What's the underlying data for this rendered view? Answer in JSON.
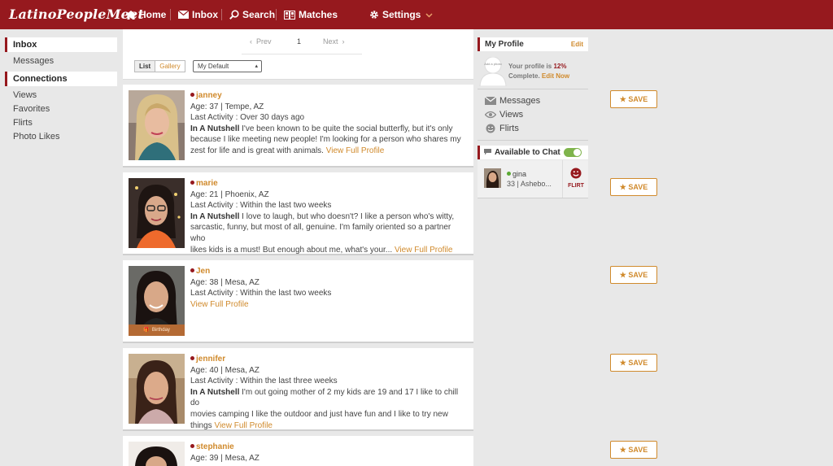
{
  "header": {
    "logo": "LatinoPeopleMeet",
    "nav": [
      {
        "label": "Home"
      },
      {
        "label": "Inbox"
      },
      {
        "label": "Search"
      },
      {
        "label": "Matches"
      },
      {
        "label": "Settings"
      }
    ]
  },
  "sidebar": {
    "inbox_header": "Inbox",
    "inbox_items": [
      "Messages"
    ],
    "connections_header": "Connections",
    "connections_items": [
      "Views",
      "Favorites",
      "Flirts",
      "Photo Likes"
    ]
  },
  "pager": {
    "prev": "Prev",
    "page": "1",
    "next": "Next",
    "view_list": "List",
    "view_gallery": "Gallery",
    "sort_selected": "My Default"
  },
  "profiles": [
    {
      "name": "janney",
      "age_loc": "Age: 37 | Tempe, AZ",
      "activity": "Last Activity : Over 30 days ago",
      "nutshell_label": "In A Nutshell",
      "lines": [
        "I've been known to be quite the social butterfly, but it's only",
        "because I like meeting new people! I'm looking for a person who shares my",
        "zest for life and is great with animals."
      ],
      "link": "View Full Profile"
    },
    {
      "name": "marie",
      "age_loc": "Age: 21 | Phoenix, AZ",
      "activity": "Last Activity : Within the last two weeks",
      "nutshell_label": "In A Nutshell",
      "lines": [
        "I love to laugh, but who doesn't? I like a person who's witty,",
        "sarcastic, funny, but most of all, genuine. I'm family oriented so a partner who",
        "likes kids is a must! But enough about me, what's your..."
      ],
      "link": "View Full Profile"
    },
    {
      "name": "Jen",
      "age_loc": "Age: 38 | Mesa, AZ",
      "activity": "Last Activity : Within the last two weeks",
      "link": "View Full Profile",
      "badge": "Birthday"
    },
    {
      "name": "jennifer",
      "age_loc": "Age: 40 | Mesa, AZ",
      "activity": "Last Activity : Within the last three weeks",
      "nutshell_label": "In A Nutshell",
      "lines": [
        "I'm out going mother of 2 my kids are 19 and 17 I like to chill do",
        "movies camping I like the outdoor and just have fun and I like to try new",
        "things"
      ],
      "link": "View Full Profile"
    },
    {
      "name": "stephanie",
      "age_loc": "Age: 39 | Mesa, AZ"
    }
  ],
  "my_profile": {
    "title": "My Profile",
    "edit": "Edit",
    "add_photo": "Add a photo",
    "progress_prefix": "Your profile is",
    "progress_pct": "12%",
    "progress_suffix": "Complete.",
    "edit_now": "Edit Now",
    "links": [
      "Messages",
      "Views",
      "Flirts"
    ]
  },
  "chat": {
    "title": "Available to Chat",
    "user_name": "gina",
    "user_sub": "33 | Ashebo...",
    "flirt": "FLIRT"
  },
  "save_label": "SAVE",
  "colors": {
    "brand": "#96191e",
    "accent": "#d08a2c",
    "online": "#5aa832"
  }
}
